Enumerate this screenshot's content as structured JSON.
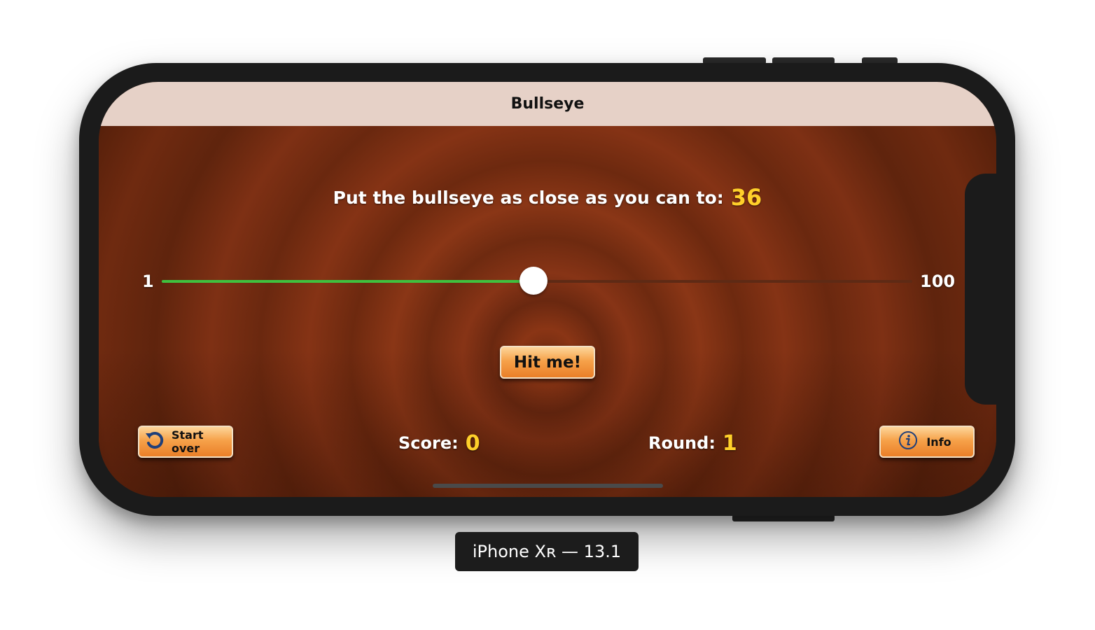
{
  "simulator": {
    "device_label": "iPhone Xʀ — 13.1"
  },
  "navbar": {
    "title": "Bullseye"
  },
  "game": {
    "prompt_label": "Put the bullseye as close as you can to:",
    "target_value": "36",
    "slider": {
      "min_label": "1",
      "max_label": "100",
      "value": 50,
      "fill_color": "#3fc13f"
    },
    "hit_button_label": "Hit me!",
    "start_over_label": "Start over",
    "start_over_icon": "restart-icon",
    "info_label": "Info",
    "info_icon": "info-circle-icon",
    "score_label": "Score:",
    "score_value": "0",
    "round_label": "Round:",
    "round_value": "1",
    "accent_color": "#ffd02a"
  }
}
